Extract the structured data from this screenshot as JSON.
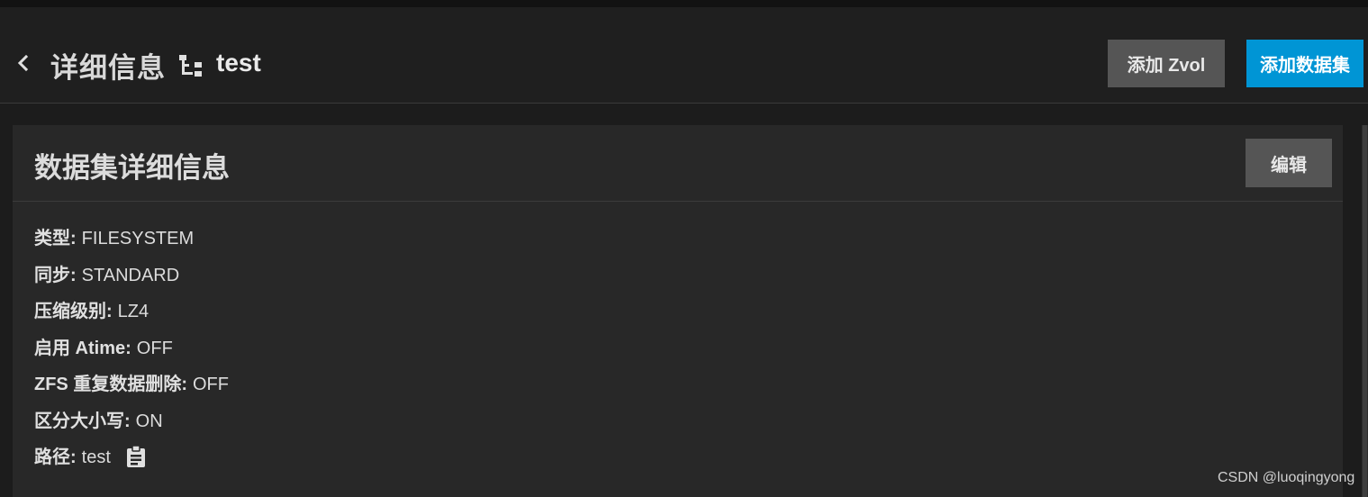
{
  "header": {
    "back_icon": "chevron-left-icon",
    "title": "详细信息",
    "dataset_icon": "account-tree-icon",
    "dataset_name": "test",
    "add_zvol_label": "添加 Zvol",
    "add_dataset_label": "添加数据集"
  },
  "card": {
    "title": "数据集详细信息",
    "edit_label": "编辑",
    "properties": [
      {
        "key": "类型:",
        "value": "FILESYSTEM"
      },
      {
        "key": "同步:",
        "value": "STANDARD"
      },
      {
        "key": "压缩级别:",
        "value": "LZ4"
      },
      {
        "key": "启用 Atime:",
        "value": "OFF"
      },
      {
        "key": "ZFS 重复数据删除:",
        "value": "OFF"
      },
      {
        "key": "区分大小写:",
        "value": "ON"
      },
      {
        "key": "路径:",
        "value": "test"
      }
    ],
    "copy_icon": "clipboard-copy-icon"
  },
  "watermark": "CSDN @luoqingyong",
  "colors": {
    "background": "#1c1c1c",
    "card": "#282828",
    "primary_button": "#0095d5",
    "secondary_button": "#555555"
  }
}
